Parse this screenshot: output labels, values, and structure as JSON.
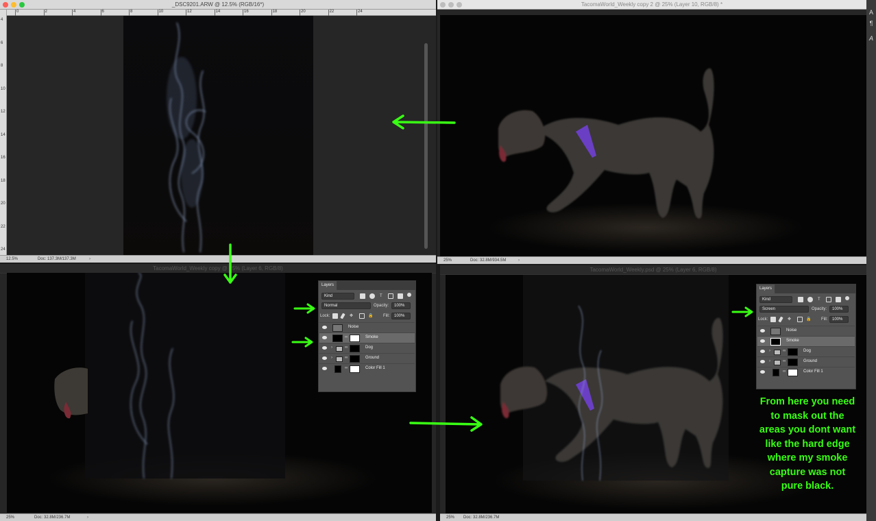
{
  "windows": {
    "top_left": {
      "title": "_DSC9201.ARW @ 12.5% (RGB/16*)",
      "zoom": "12.5%",
      "doc": "Doc: 137.3M/137.3M"
    },
    "top_right": {
      "title": "TacomaWorld_Weekly copy 2 @ 25% (Layer 10, RGB/8) *",
      "zoom": "25%",
      "doc": "Doc: 32.8M/934.5M"
    },
    "bottom_left": {
      "title": "TacomaWorld_Weekly copy @ 25% (Layer 6, RGB/8)",
      "zoom": "25%",
      "doc": "Doc: 32.8M/236.7M"
    },
    "bottom_right": {
      "title": "TacomaWorld_Weekly.psd @ 25% (Layer 6, RGB/8)",
      "zoom": "25%",
      "doc": "Doc: 32.8M/236.7M"
    }
  },
  "rulers": {
    "top_left_h": [
      "0",
      "2",
      "4",
      "6",
      "8",
      "10",
      "12",
      "14",
      "16",
      "18",
      "20",
      "22",
      "24"
    ],
    "top_left_v": [
      "4",
      "6",
      "8",
      "10",
      "12",
      "14",
      "16",
      "18",
      "20",
      "22",
      "24"
    ]
  },
  "layers_left": {
    "tab": "Layers",
    "filter_kind": "Kind",
    "blend_mode": "Normal",
    "opacity_label": "Opacity:",
    "opacity_value": "100%",
    "lock_label": "Lock:",
    "fill_label": "Fill:",
    "fill_value": "100%",
    "items": [
      {
        "name": "Noise"
      },
      {
        "name": "Smoke"
      },
      {
        "name": "Dog"
      },
      {
        "name": "Ground"
      },
      {
        "name": "Color Fill 1"
      }
    ]
  },
  "layers_right": {
    "tab": "Layers",
    "filter_kind": "Kind",
    "blend_mode": "Screen",
    "opacity_label": "Opacity:",
    "opacity_value": "100%",
    "lock_label": "Lock:",
    "fill_label": "Fill:",
    "fill_value": "100%",
    "items": [
      {
        "name": "Noise"
      },
      {
        "name": "Smoke"
      },
      {
        "name": "Dog"
      },
      {
        "name": "Ground"
      },
      {
        "name": "Color Fill 1"
      }
    ]
  },
  "annotation": {
    "lines": [
      "From here you need",
      "to mask out the",
      "areas you dont want",
      "like the hard edge",
      "where my smoke",
      "capture was not",
      "pure black."
    ]
  },
  "right_strip": {
    "tools": [
      "A",
      "¶",
      "A"
    ]
  },
  "colors": {
    "annotation": "#39ff14",
    "arrow": "#39ff14",
    "harness": "#6a3fc4"
  }
}
